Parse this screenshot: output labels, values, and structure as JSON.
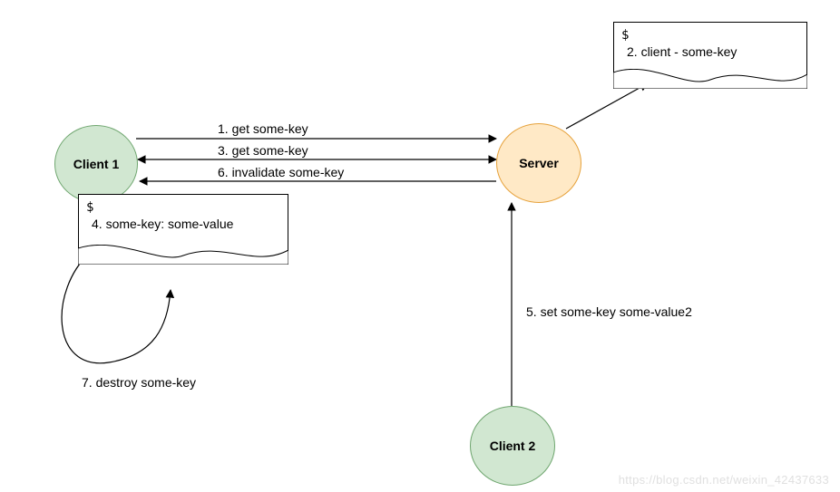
{
  "nodes": {
    "client1": {
      "label": "Client 1"
    },
    "server": {
      "label": "Server"
    },
    "client2": {
      "label": "Client 2"
    }
  },
  "notes": {
    "server_note": {
      "prompt": "$",
      "line": "2. client  -  some-key"
    },
    "client1_note": {
      "prompt": "$",
      "line": "4. some-key: some-value"
    }
  },
  "edges": {
    "e1": "1. get some-key",
    "e3": "3. get some-key",
    "e6": "6. invalidate some-key",
    "e5": "5. set some-key some-value2",
    "e7": "7. destroy some-key"
  },
  "watermark": "https://blog.csdn.net/weixin_42437633",
  "colors": {
    "client_fill": "#d1e7d1",
    "client_stroke": "#6fa66f",
    "server_fill": "#ffe9c6",
    "server_stroke": "#e6a23c",
    "line": "#000000"
  }
}
